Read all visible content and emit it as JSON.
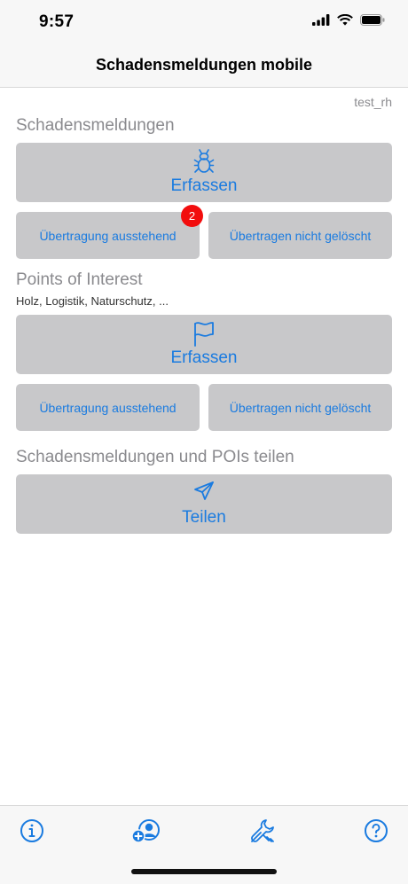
{
  "status_bar": {
    "time": "9:57",
    "icons": [
      "signal-icon",
      "wifi-icon",
      "battery-icon"
    ]
  },
  "header": {
    "title": "Schadensmeldungen mobile"
  },
  "user": "test_rh",
  "sections": {
    "damage": {
      "title": "Schadensmeldungen",
      "capture_label": "Erfassen",
      "capture_icon": "bug-icon",
      "pending_label": "Übertragung ausstehend",
      "pending_count": "2",
      "not_deleted_label": "Übertragen nicht gelöscht"
    },
    "poi": {
      "title": "Points of Interest",
      "subtitle": "Holz, Logistik, Naturschutz, ...",
      "capture_label": "Erfassen",
      "capture_icon": "flag-icon",
      "pending_label": "Übertragung ausstehend",
      "not_deleted_label": "Übertragen nicht gelöscht"
    },
    "share": {
      "title": "Schadensmeldungen und POIs teilen",
      "share_label": "Teilen",
      "share_icon": "send-icon"
    }
  },
  "tab_bar": [
    "info-icon",
    "add-user-icon",
    "tools-icon",
    "help-icon"
  ],
  "colors": {
    "accent": "#1a7be0",
    "button_bg": "#c8c8ca",
    "badge": "#f20d0d",
    "section_title": "#8a8a8e"
  }
}
